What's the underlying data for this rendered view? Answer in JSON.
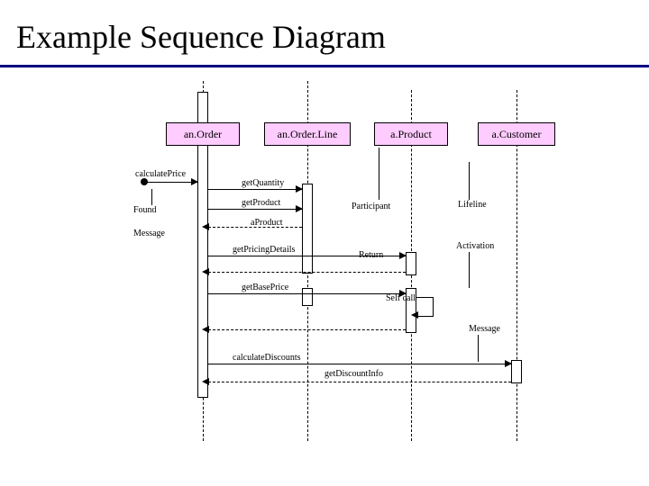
{
  "title": "Example Sequence Diagram",
  "participants": {
    "order": "an.Order",
    "orderLine": "an.Order.Line",
    "product": "a.Product",
    "customer": "a.Customer"
  },
  "messages": {
    "calculatePrice": "calculatePrice",
    "getQuantity": "getQuantity",
    "getProduct": "getProduct",
    "aProduct": "aProduct",
    "getPricingDetails": "getPricingDetails",
    "getBasePrice": "getBasePrice",
    "calculateDiscounts": "calculateDiscounts",
    "getDiscountInfo": "getDiscountInfo"
  },
  "notes": {
    "found": "Found",
    "message": "Message",
    "participant": "Participant",
    "lifeline": "Lifeline",
    "return": "Return",
    "activation": "Activation",
    "selfcall": "Self call",
    "msg2": "Message"
  }
}
